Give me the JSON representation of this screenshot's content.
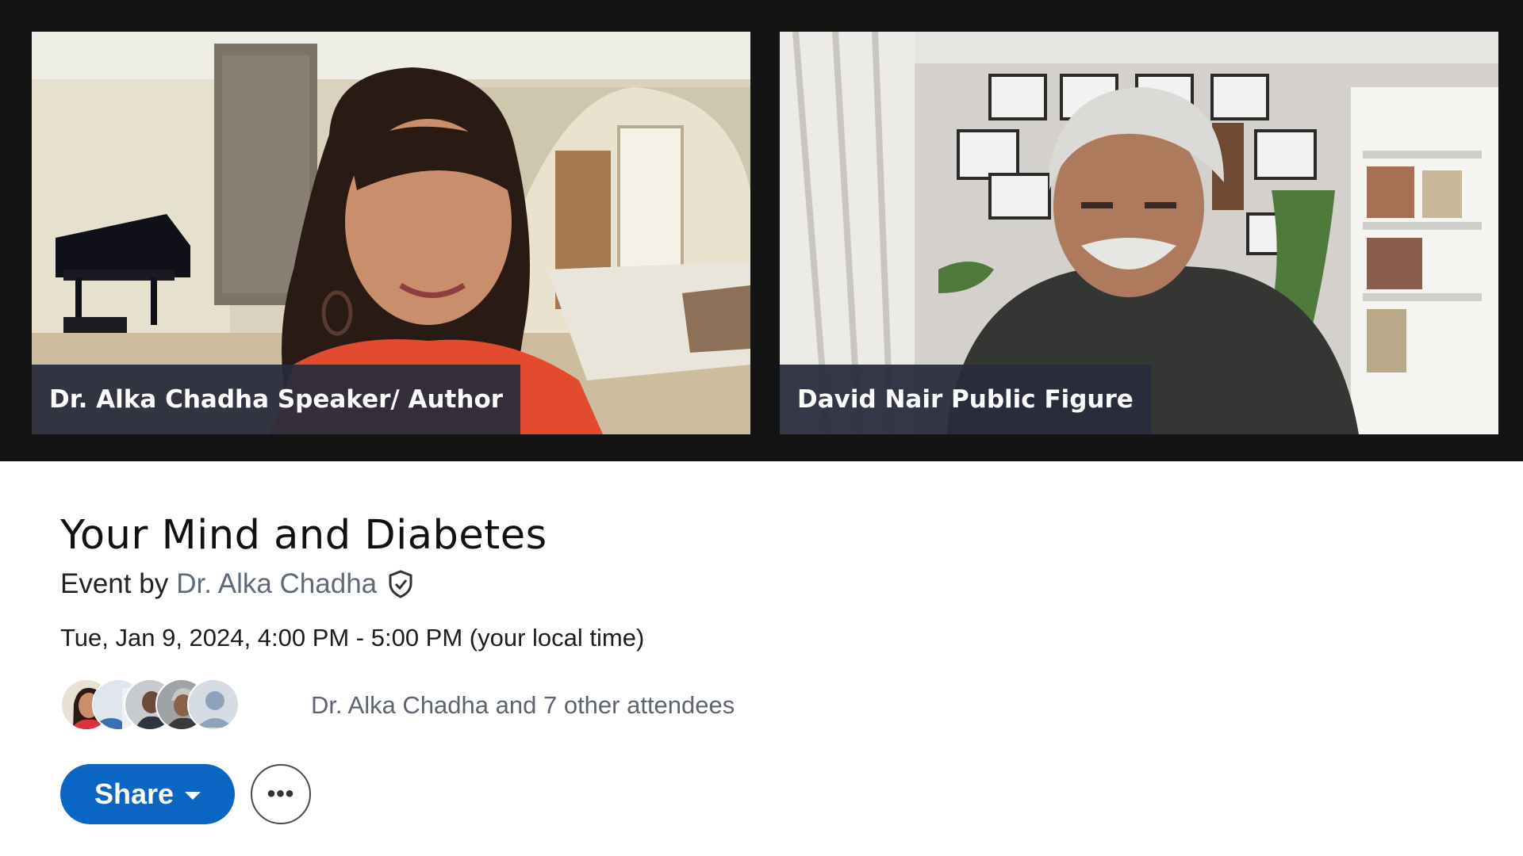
{
  "video": {
    "speakers": [
      {
        "name_label": "Dr. Alka Chadha Speaker/ Author"
      },
      {
        "name_label": "David Nair Public Figure"
      }
    ]
  },
  "event": {
    "title": "Your Mind and Diabetes",
    "host_prefix": "Event by",
    "host_name": "Dr. Alka Chadha",
    "host_badge_icon": "verified-shield-icon",
    "datetime": "Tue, Jan 9, 2024, 4:00 PM - 5:00 PM (your local time)",
    "attendees_text": "Dr. Alka Chadha and 7 other attendees"
  },
  "actions": {
    "share_label": "Share",
    "share_caret_icon": "caret-down-icon",
    "more_icon": "ellipsis-icon",
    "more_label": "•••"
  },
  "colors": {
    "accent": "#0a66c2",
    "stage_bg": "#141414",
    "nameplate_bg": "#282c3c",
    "host_link": "#5e6a78"
  }
}
